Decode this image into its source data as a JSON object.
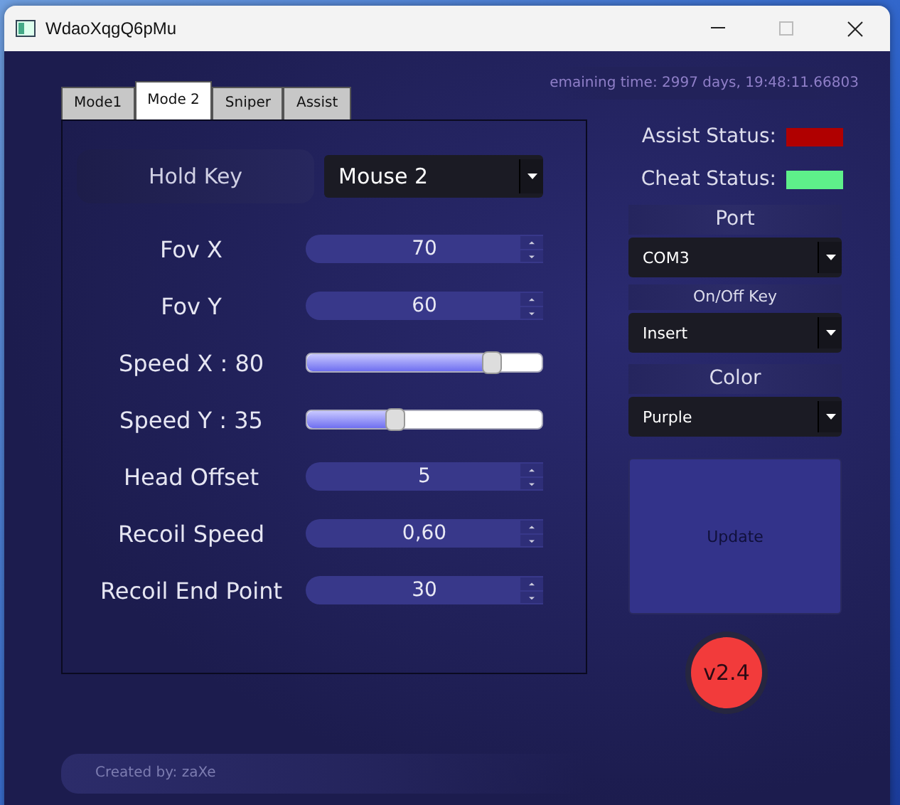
{
  "window": {
    "title": "WdaoXqgQ6pMu"
  },
  "remaining_time": "emaining time: 2997 days, 19:48:11.66803",
  "tabs": [
    {
      "label": "Mode1",
      "selected": false
    },
    {
      "label": "Mode 2",
      "selected": true
    },
    {
      "label": "Sniper",
      "selected": false
    },
    {
      "label": "Assist",
      "selected": false
    }
  ],
  "hold_key": {
    "label": "Hold Key",
    "value": "Mouse 2"
  },
  "settings": [
    {
      "kind": "spin",
      "label": "Fov X",
      "value": "70"
    },
    {
      "kind": "spin",
      "label": "Fov Y",
      "value": "60"
    },
    {
      "kind": "slider",
      "label": "Speed X : 80",
      "level": 0.78
    },
    {
      "kind": "slider",
      "label": "Speed Y : 35",
      "level": 0.37
    },
    {
      "kind": "spin",
      "label": "Head Offset",
      "value": "5"
    },
    {
      "kind": "spin",
      "label": "Recoil Speed",
      "value": "0,60"
    },
    {
      "kind": "spin",
      "label": "Recoil End Point",
      "value": "30"
    }
  ],
  "status": [
    {
      "label": "Assist Status:",
      "color": "#b00000"
    },
    {
      "label": "Cheat Status:",
      "color": "#5ef08a"
    }
  ],
  "selectors": [
    {
      "kind": "heading",
      "text": "Port"
    },
    {
      "kind": "dropdown",
      "value": "COM3"
    },
    {
      "kind": "caption",
      "text": "On/Off Key"
    },
    {
      "kind": "dropdown",
      "value": "Insert"
    },
    {
      "kind": "heading",
      "text": "Color"
    },
    {
      "kind": "dropdown",
      "value": "Purple"
    }
  ],
  "update_button": "Update",
  "version": "v2.4",
  "credit": "Created by: zaXe"
}
